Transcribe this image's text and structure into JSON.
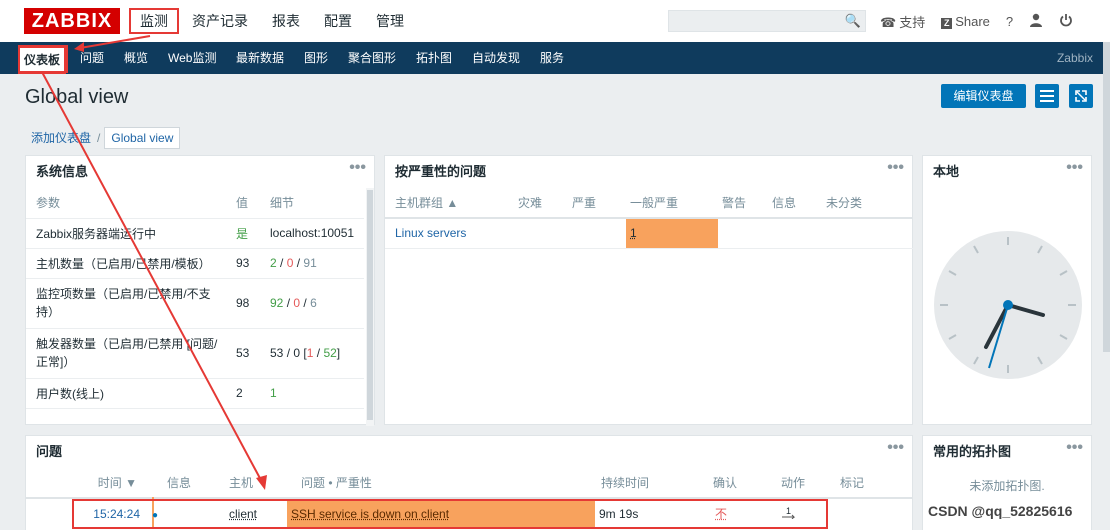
{
  "topbar": {
    "logo": "ZABBIX",
    "menu": [
      "监测",
      "资产记录",
      "报表",
      "配置",
      "管理"
    ],
    "support": "支持",
    "share": "Share",
    "help": "?"
  },
  "subnav": {
    "items": [
      "仪表板",
      "问题",
      "概览",
      "Web监测",
      "最新数据",
      "图形",
      "聚合图形",
      "拓扑图",
      "自动发现",
      "服务"
    ],
    "brand": "Zabbix"
  },
  "page": {
    "title": "Global view",
    "edit_button": "编辑仪表盘",
    "breadcrumb": [
      "添加仪表盘",
      "/",
      "Global view"
    ]
  },
  "system_info": {
    "title": "系统信息",
    "headers": [
      "参数",
      "值",
      "细节"
    ],
    "rows": [
      {
        "param": "Zabbix服务器端运行中",
        "value": "是",
        "detail": "localhost:10051"
      },
      {
        "param": "主机数量（已启用/已禁用/模板）",
        "value": "93",
        "d1": "2",
        "d2": "0",
        "d3": "91"
      },
      {
        "param": "监控项数量（已启用/已禁用/不支持）",
        "value": "98",
        "d1": "92",
        "d2": "0",
        "d3": "6"
      },
      {
        "param": "触发器数量（已启用/已禁用 [问题/正常]）",
        "value": "53",
        "d1": "53",
        "d2": "0",
        "d3": "1",
        "d4": "52"
      },
      {
        "param": "用户数(线上)",
        "value": "2",
        "detail": "1"
      }
    ]
  },
  "severity": {
    "title": "按严重性的问题",
    "headers": [
      "主机群组 ▲",
      "灾难",
      "严重",
      "一般严重",
      "警告",
      "信息",
      "未分类"
    ],
    "rows": [
      {
        "group": "Linux servers",
        "average": "1"
      }
    ]
  },
  "local": {
    "title": "本地"
  },
  "problems": {
    "title": "问题",
    "headers": [
      "时间 ▼",
      "信息",
      "主机",
      "问题 • 严重性",
      "持续时间",
      "确认",
      "动作",
      "标记"
    ],
    "rows": [
      {
        "time": "15:24:24",
        "host": "client",
        "problem": "SSH service is down on client",
        "duration": "9m 19s",
        "ack": "不"
      }
    ]
  },
  "maps": {
    "title": "常用的拓扑图",
    "empty": "未添加拓扑图."
  },
  "watermark": "CSDN @qq_52825616",
  "colors": {
    "accent": "#0275b8",
    "nav": "#0f3b5d",
    "logo": "#d40000",
    "average": "#f8a25d",
    "highlight": "#e53935"
  }
}
